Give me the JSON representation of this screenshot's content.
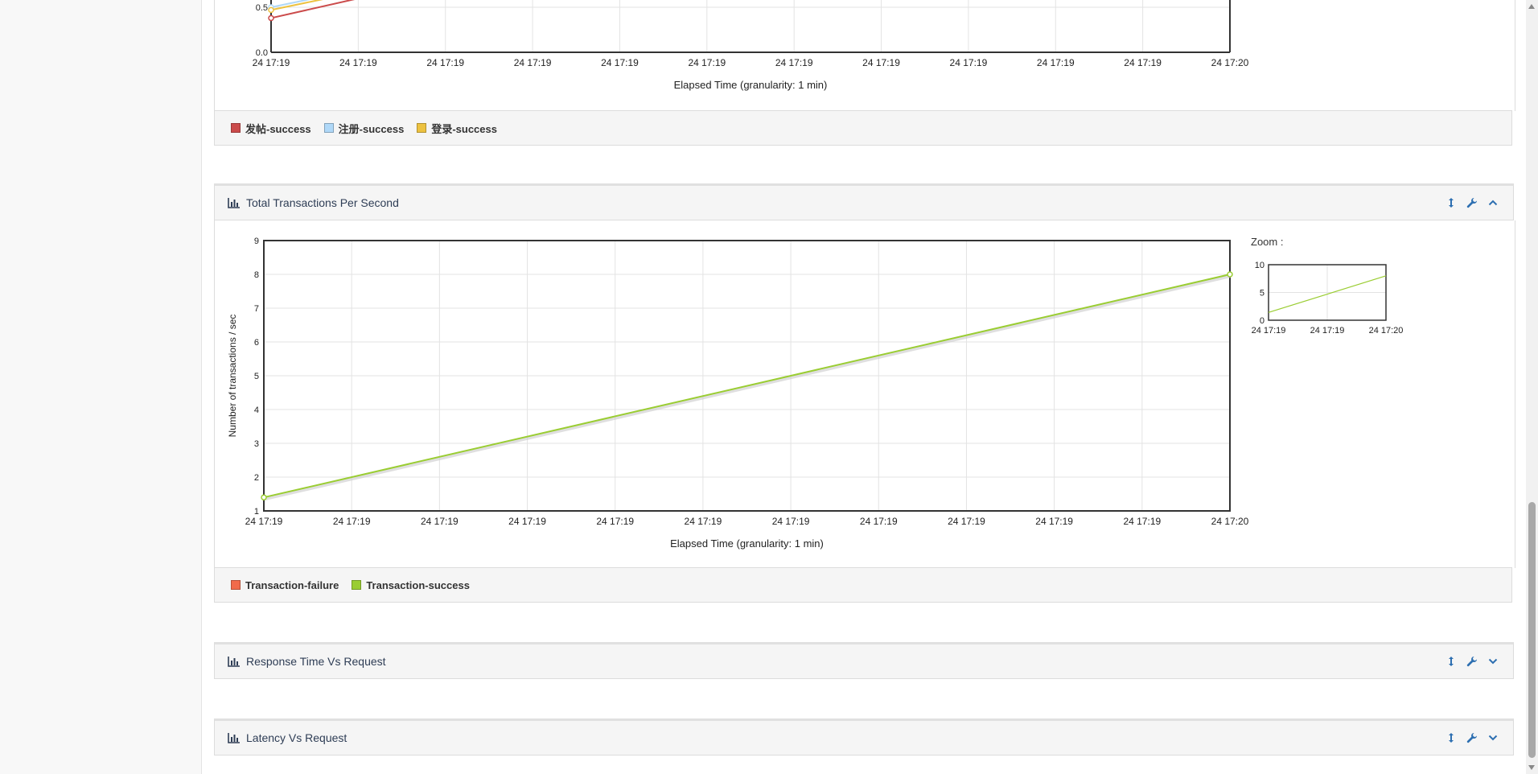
{
  "colors": {
    "accent": "#2d6fb1",
    "fabu": "#cb4b4b",
    "zhuce": "#afd8f8",
    "denglu": "#edc240",
    "transaction_failure": "#f16b4b",
    "transaction_success": "#9acd32"
  },
  "top_chart": {
    "x_title": "Elapsed Time (granularity: 1 min)",
    "legend": [
      {
        "label": "发帖-success",
        "color": "#cb4b4b"
      },
      {
        "label": "注册-success",
        "color": "#afd8f8"
      },
      {
        "label": "登录-success",
        "color": "#edc240"
      }
    ]
  },
  "tps_panel": {
    "title": "Total Transactions Per Second",
    "title_icon": "bar-chart-icon",
    "tools": [
      "resize-vertical-icon",
      "wrench-icon",
      "chevron-up-icon"
    ],
    "legend": [
      {
        "label": "Transaction-failure",
        "color": "#f16b4b"
      },
      {
        "label": "Transaction-success",
        "color": "#9acd32"
      }
    ],
    "zoom_label": "Zoom :"
  },
  "response_panel": {
    "title": "Response Time Vs Request",
    "tools": [
      "resize-vertical-icon",
      "wrench-icon",
      "chevron-down-icon"
    ]
  },
  "latency_panel": {
    "title": "Latency Vs Request",
    "tools": [
      "resize-vertical-icon",
      "wrench-icon",
      "chevron-down-icon"
    ]
  },
  "chart_data": [
    {
      "type": "line",
      "title": "",
      "xlabel": "Elapsed Time (granularity: 1 min)",
      "ylabel": "",
      "x_ticks": [
        "24 17:19",
        "24 17:19",
        "24 17:19",
        "24 17:19",
        "24 17:19",
        "24 17:19",
        "24 17:19",
        "24 17:19",
        "24 17:19",
        "24 17:19",
        "24 17:19",
        "24 17:20"
      ],
      "y_ticks_visible": [
        "0.0",
        "0.5"
      ],
      "ylim_visible": [
        0,
        0.55
      ],
      "series": [
        {
          "name": "发帖-success",
          "color": "#cb4b4b",
          "x": [
            0,
            0.1
          ],
          "y": [
            0.38,
            0.62
          ]
        },
        {
          "name": "注册-success",
          "color": "#afd8f8",
          "x": [
            0,
            0.1
          ],
          "y": [
            0.5,
            0.72
          ]
        },
        {
          "name": "登录-success",
          "color": "#edc240",
          "x": [
            0,
            0.1
          ],
          "y": [
            0.47,
            0.69
          ]
        }
      ],
      "grid": true,
      "legend": "bottom"
    },
    {
      "type": "line",
      "title": "Total Transactions Per Second",
      "xlabel": "Elapsed Time (granularity: 1 min)",
      "ylabel": "Number of transactions / sec",
      "x_ticks": [
        "24 17:19",
        "24 17:19",
        "24 17:19",
        "24 17:19",
        "24 17:19",
        "24 17:19",
        "24 17:19",
        "24 17:19",
        "24 17:19",
        "24 17:19",
        "24 17:19",
        "24 17:20"
      ],
      "y_ticks": [
        1,
        2,
        3,
        4,
        5,
        6,
        7,
        8,
        9
      ],
      "ylim": [
        1,
        9
      ],
      "series": [
        {
          "name": "Transaction-success",
          "color": "#9acd32",
          "x": [
            0,
            1
          ],
          "y": [
            1.4,
            8.0
          ]
        }
      ],
      "grid": true,
      "legend": "bottom"
    },
    {
      "type": "line",
      "title": "Zoom :",
      "x_ticks": [
        "24 17:19",
        "24 17:19",
        "24 17:20"
      ],
      "y_ticks": [
        0,
        5,
        10
      ],
      "ylim": [
        0,
        10
      ],
      "series": [
        {
          "name": "Transaction-success",
          "color": "#9acd32",
          "x": [
            0,
            1
          ],
          "y": [
            1.4,
            8.0
          ]
        }
      ]
    }
  ]
}
